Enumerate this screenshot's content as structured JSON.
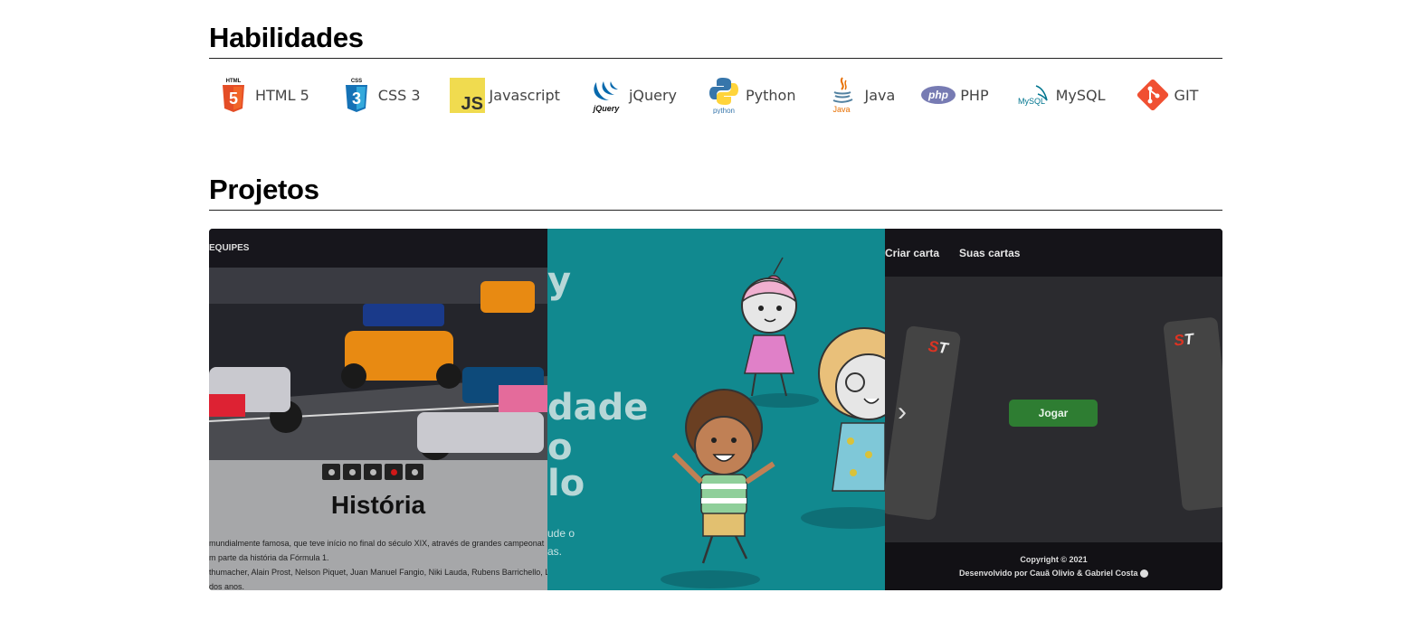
{
  "skills_section": {
    "title": "Habilidades"
  },
  "skills": [
    {
      "label": "HTML 5",
      "icon": "html5-icon",
      "color": "#e44d26"
    },
    {
      "label": "CSS 3",
      "icon": "css3-icon",
      "color": "#1572b6"
    },
    {
      "label": "Javascript",
      "icon": "javascript-icon",
      "color": "#f0db4f"
    },
    {
      "label": "jQuery",
      "icon": "jquery-icon",
      "color": "#0769ad"
    },
    {
      "label": "Python",
      "icon": "python-icon",
      "color": "#3776ab"
    },
    {
      "label": "Java",
      "icon": "java-icon",
      "color": "#e76f00"
    },
    {
      "label": "PHP",
      "icon": "php-icon",
      "color": "#777bb3"
    },
    {
      "label": "MySQL",
      "icon": "mysql-icon",
      "color": "#00758f"
    },
    {
      "label": "GIT",
      "icon": "git-icon",
      "color": "#f05032"
    }
  ],
  "icon_text": {
    "html": "HTML",
    "html_num": "5",
    "css": "CSS",
    "css_num": "3",
    "js": "JS",
    "jquery": "jQuery",
    "python": "python",
    "java": "Java",
    "php": "php",
    "mysql": "MySQL"
  },
  "projects_section": {
    "title": "Projetos"
  },
  "projects": {
    "f1": {
      "nav": "EQUIPES",
      "title": "História",
      "lines": [
        "mundialmente famosa, que teve início no final do século XIX, através de grandes campeonat",
        "m parte da história da Fórmula 1.",
        "thumacher, Alain Prost, Nelson Piquet, Juan Manuel Fangio, Niki Lauda, Rubens Barrichello, Le",
        "dos anos."
      ],
      "active_dot": 3,
      "dot_count": 5
    },
    "kids": {
      "heading_lines": [
        "y",
        "dade",
        "o",
        "lo"
      ],
      "text_lines": [
        "ude o",
        "as."
      ]
    },
    "cards": {
      "nav": [
        "Criar carta",
        "Suas cartas"
      ],
      "play_label": "Jogar",
      "card_logo_s": "S",
      "card_logo_t": "T",
      "footer_copyright": "Copyright © 2021",
      "footer_credits": "Desenvolvido por Cauã Olivio & Gabriel Costa"
    }
  }
}
